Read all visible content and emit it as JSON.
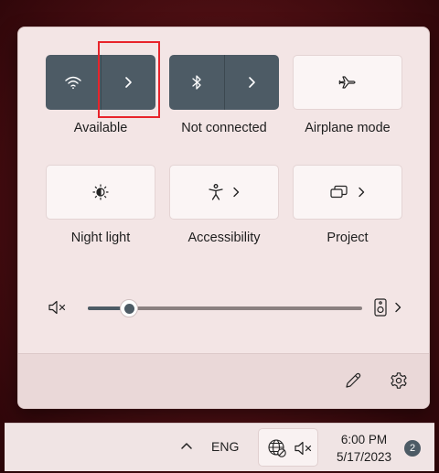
{
  "quick_settings": {
    "tiles": [
      {
        "id": "wifi",
        "label": "Available",
        "icon": "wifi-icon",
        "state": "on",
        "has_chevron": true
      },
      {
        "id": "bluetooth",
        "label": "Not connected",
        "icon": "bluetooth-icon",
        "state": "on",
        "has_chevron": true
      },
      {
        "id": "airplane",
        "label": "Airplane mode",
        "icon": "airplane-icon",
        "state": "off",
        "has_chevron": false
      },
      {
        "id": "night_light",
        "label": "Night light",
        "icon": "night-light-icon",
        "state": "off",
        "has_chevron": false
      },
      {
        "id": "accessibility",
        "label": "Accessibility",
        "icon": "accessibility-icon",
        "state": "off",
        "has_chevron": true
      },
      {
        "id": "project",
        "label": "Project",
        "icon": "project-icon",
        "state": "off",
        "has_chevron": true
      }
    ],
    "volume": {
      "muted": true,
      "level_fraction": 0.15,
      "output_icon": "speaker-device-icon"
    },
    "footer": {
      "edit_icon": "pencil-icon",
      "settings_icon": "gear-icon"
    }
  },
  "taskbar": {
    "language": "ENG",
    "time": "6:00 PM",
    "date": "5/17/2023",
    "notification_count": "2"
  },
  "colors": {
    "accent_tile": "#4d5b65",
    "panel_bg": "#f3e5e5",
    "highlight_box": "#e8232b"
  }
}
